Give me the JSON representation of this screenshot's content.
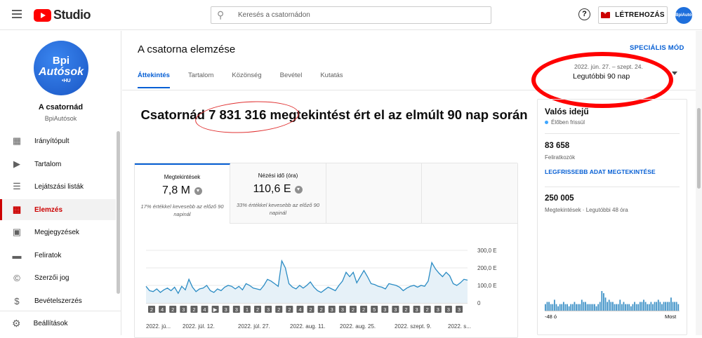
{
  "header": {
    "logo_text": "Studio",
    "search_placeholder": "Keresés a csatornádon",
    "help_label": "?",
    "create_label": "LÉTREHOZÁS",
    "avatar_text": "BpiAutósok"
  },
  "sidebar": {
    "avatar": {
      "line1": "Bpi",
      "line2": "Autósok",
      "line3": "•HU"
    },
    "channel_title": "A csatornád",
    "channel_handle": "BpiAutósok",
    "items": [
      {
        "label": "Irányítópult",
        "icon": "dashboard-icon"
      },
      {
        "label": "Tartalom",
        "icon": "content-icon"
      },
      {
        "label": "Lejátszási listák",
        "icon": "playlist-icon"
      },
      {
        "label": "Elemzés",
        "icon": "analytics-icon",
        "active": true
      },
      {
        "label": "Megjegyzések",
        "icon": "comments-icon"
      },
      {
        "label": "Feliratok",
        "icon": "subtitles-icon"
      },
      {
        "label": "Szerzői jog",
        "icon": "copyright-icon"
      },
      {
        "label": "Bevételszerzés",
        "icon": "dollar-icon"
      }
    ],
    "settings_label": "Beállítások"
  },
  "page": {
    "title": "A csatorna elemzése",
    "advanced_mode": "SPECIÁLIS MÓD",
    "tabs": [
      "Áttekintés",
      "Tartalom",
      "Közönség",
      "Bevétel",
      "Kutatás"
    ],
    "date_range_detail": "2022. jún. 27. – szept. 24.",
    "date_range_label": "Legutóbbi 90 nap",
    "headline": "Csatornád 7 831 316 megtekintést ért el az elmúlt 90 nap során"
  },
  "metrics": [
    {
      "label": "Megtekintések",
      "value": "7,8 M",
      "sub": "17% értékkel kevesebb az előző 90 napinál"
    },
    {
      "label": "Nézési idő (óra)",
      "value": "110,6 E",
      "sub": "33% értékkel kevesebb az előző 90 napinál"
    }
  ],
  "realtime": {
    "title": "Valós idejű",
    "live_label": "Élőben frissül",
    "subscribers_value": "83 658",
    "subscribers_label": "Feliratkozók",
    "link_label": "LEGFRISSEBB ADAT MEGTEKINTÉSE",
    "views_value": "250 005",
    "views_label": "Megtekintések · Legutóbbi 48 óra",
    "axis_left": "-48 ó",
    "axis_right": "Most",
    "bars": [
      3,
      4,
      4,
      3,
      3,
      5,
      3,
      2,
      3,
      3,
      4,
      3,
      3,
      2,
      3,
      3,
      4,
      3,
      3,
      3,
      5,
      4,
      4,
      3,
      3,
      3,
      3,
      3,
      2,
      3,
      4,
      9,
      8,
      6,
      4,
      5,
      4,
      4,
      3,
      3,
      3,
      5,
      3,
      4,
      3,
      3,
      3,
      2,
      3,
      4,
      3,
      3,
      4,
      4,
      5,
      4,
      3,
      3,
      4,
      3,
      4,
      4,
      5,
      4,
      3,
      4,
      4,
      4,
      4,
      6,
      4,
      4,
      4,
      3
    ]
  },
  "chart_data": {
    "type": "area",
    "title": "",
    "series": [
      {
        "name": "Megtekintések",
        "values": [
          95,
          70,
          65,
          80,
          60,
          75,
          85,
          70,
          90,
          55,
          95,
          75,
          135,
          90,
          65,
          80,
          85,
          100,
          70,
          60,
          80,
          70,
          90,
          100,
          95,
          80,
          95,
          75,
          110,
          100,
          85,
          80,
          75,
          100,
          135,
          125,
          110,
          95,
          240,
          200,
          110,
          90,
          80,
          100,
          85,
          100,
          120,
          90,
          70,
          60,
          75,
          90,
          80,
          70,
          100,
          125,
          175,
          150,
          175,
          115,
          150,
          185,
          150,
          110,
          105,
          95,
          90,
          80,
          110,
          105,
          100,
          90,
          70,
          85,
          95,
          100,
          90,
          100,
          95,
          125,
          230,
          195,
          170,
          150,
          175,
          155,
          110,
          100,
          115,
          135,
          130
        ]
      }
    ],
    "y_ticks": [
      "300,0 E",
      "200,0 E",
      "100,0 E",
      "0"
    ],
    "ylim": [
      0,
      300
    ],
    "x_ticks": [
      "2022. jú...",
      "2022. júl. 12.",
      "2022. júl. 27.",
      "2022. aug. 11.",
      "2022. aug. 25.",
      "2022. szept. 9.",
      "2022. s..."
    ],
    "grid": true,
    "markers": [
      "2",
      "4",
      "2",
      "3",
      "2",
      "4",
      "▶",
      "3",
      "3",
      "1",
      "2",
      "3",
      "2",
      "2",
      "4",
      "2",
      "2",
      "3",
      "3",
      "2",
      "2",
      "5",
      "3",
      "3",
      "2",
      "3",
      "2",
      "3",
      "3",
      "3"
    ]
  }
}
